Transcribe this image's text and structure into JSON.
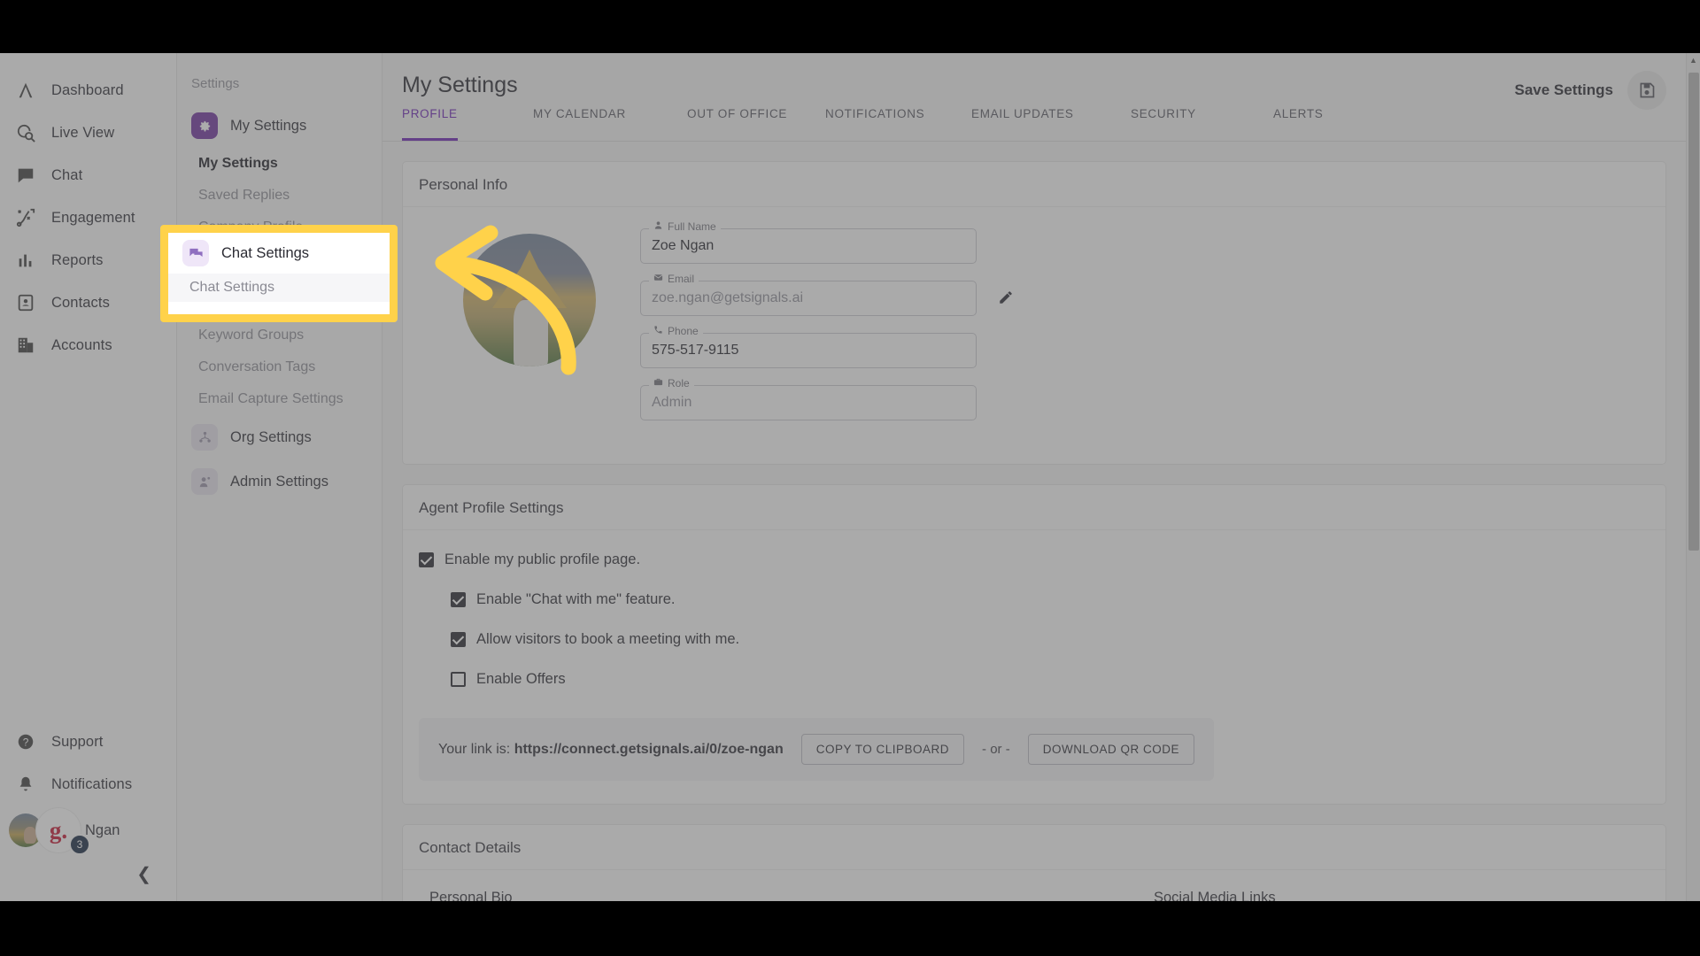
{
  "rail": {
    "items": [
      {
        "label": "Dashboard",
        "icon": "logo-a-icon"
      },
      {
        "label": "Live View",
        "icon": "globe-search-icon"
      },
      {
        "label": "Chat",
        "icon": "chat-bubble-icon"
      },
      {
        "label": "Engagement",
        "icon": "engagement-flow-icon"
      },
      {
        "label": "Reports",
        "icon": "bar-chart-icon"
      },
      {
        "label": "Contacts",
        "icon": "contact-card-icon"
      },
      {
        "label": "Accounts",
        "icon": "building-icon"
      }
    ],
    "bottom": [
      {
        "label": "Support",
        "icon": "question-circle-icon"
      },
      {
        "label": "Notifications",
        "icon": "bell-icon"
      }
    ],
    "user": {
      "name": "Ngan",
      "badge_initial": "g.",
      "notification_count": "3"
    },
    "collapse_icon": "chevron-left-icon"
  },
  "subpanel": {
    "title": "Settings",
    "groups": [
      {
        "label": "My Settings",
        "icon": "gear-icon",
        "state": "active",
        "children": [
          {
            "label": "My Settings",
            "selected": true
          },
          {
            "label": "Saved Replies",
            "selected": false
          },
          {
            "label": "Company Profile",
            "selected": false
          }
        ]
      },
      {
        "label": "Chat Settings",
        "icon": "chat-settings-icon",
        "state": "soft",
        "children": [
          {
            "label": "Chat Settings",
            "selected": false
          },
          {
            "label": "Keyword Groups",
            "selected": false
          },
          {
            "label": "Conversation Tags",
            "selected": false
          },
          {
            "label": "Email Capture Settings",
            "selected": false
          }
        ]
      },
      {
        "label": "Org Settings",
        "icon": "org-users-icon",
        "state": "mute",
        "children": []
      },
      {
        "label": "Admin Settings",
        "icon": "admin-user-icon",
        "state": "mute",
        "children": []
      }
    ]
  },
  "header": {
    "title": "My Settings",
    "save_label": "Save Settings",
    "save_icon": "save-disk-icon",
    "tabs": [
      {
        "label": "PROFILE",
        "active": true
      },
      {
        "label": "MY CALENDAR",
        "active": false
      },
      {
        "label": "OUT OF OFFICE",
        "active": false
      },
      {
        "label": "NOTIFICATIONS",
        "active": false
      },
      {
        "label": "EMAIL UPDATES",
        "active": false
      },
      {
        "label": "SECURITY",
        "active": false
      },
      {
        "label": "ALERTS",
        "active": false
      }
    ]
  },
  "personal_info": {
    "section_title": "Personal Info",
    "fields": {
      "full_name": {
        "label": "Full Name",
        "value": "Zoe Ngan",
        "icon": "person-icon",
        "is_placeholder": false
      },
      "email": {
        "label": "Email",
        "value": "zoe.ngan@getsignals.ai",
        "icon": "envelope-icon",
        "is_placeholder": true
      },
      "phone": {
        "label": "Phone",
        "value": "575-517-9115",
        "icon": "phone-icon",
        "is_placeholder": false
      },
      "role": {
        "label": "Role",
        "value": "Admin",
        "icon": "briefcase-icon",
        "is_placeholder": true
      }
    },
    "edit_icon": "pencil-icon"
  },
  "agent_profile": {
    "section_title": "Agent Profile Settings",
    "checkboxes": [
      {
        "label": "Enable my public profile page.",
        "checked": true,
        "indent": false
      },
      {
        "label": "Enable \"Chat with me\" feature.",
        "checked": true,
        "indent": true
      },
      {
        "label": "Allow visitors to book a meeting with me.",
        "checked": true,
        "indent": true
      },
      {
        "label": "Enable Offers",
        "checked": false,
        "indent": true
      }
    ],
    "link_prefix": "Your link is:",
    "link_url": "https://connect.getsignals.ai/0/zoe-ngan",
    "copy_button": "COPY TO CLIPBOARD",
    "or_text": "- or -",
    "qr_button": "DOWNLOAD QR CODE"
  },
  "contact_details": {
    "section_title": "Contact Details",
    "left_label": "Personal Bio",
    "right_label": "Social Media Links"
  },
  "annotation": {
    "highlight_target": "Chat Settings",
    "arrow_icon": "curved-left-arrow",
    "colors": {
      "highlight": "#ffd24a",
      "accent": "#6a1fb5"
    }
  },
  "scrollbar": {
    "up_arrow": "scroll-up-arrow"
  }
}
